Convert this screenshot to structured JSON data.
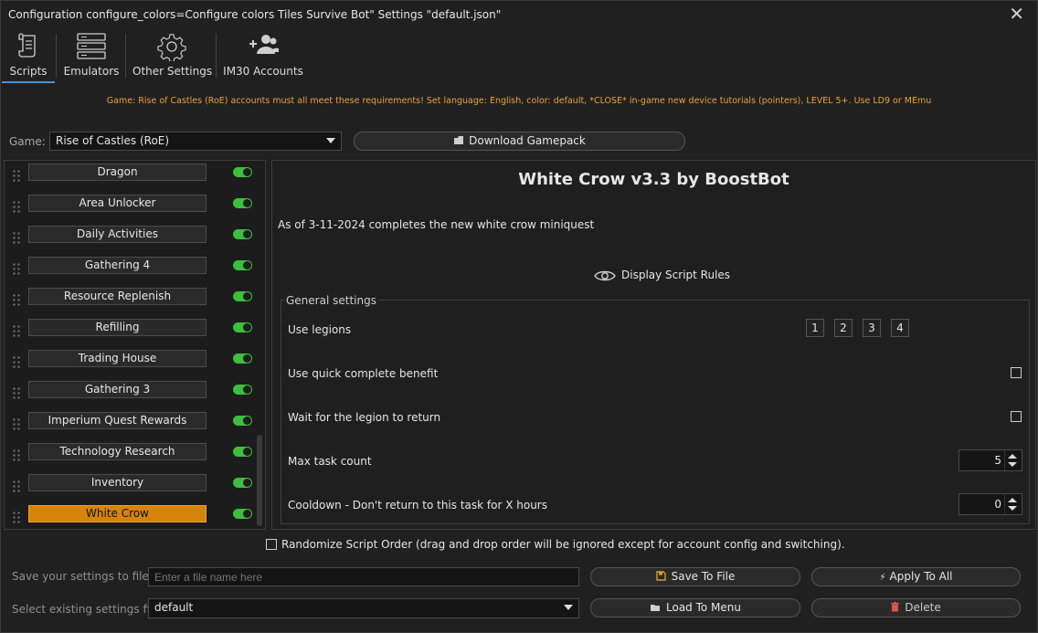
{
  "window": {
    "title": "Configuration configure_colors=Configure colors Tiles Survive Bot\" Settings \"default.json\"",
    "close_glyph": "✕"
  },
  "tabs": [
    {
      "label": "Scripts",
      "icon": "scroll-icon"
    },
    {
      "label": "Emulators",
      "icon": "server-icon"
    },
    {
      "label": "Other Settings",
      "icon": "gear-icon"
    },
    {
      "label": "IM30 Accounts",
      "icon": "users-add-icon"
    }
  ],
  "notice": "Game: Rise of Castles (RoE) accounts must all meet these requirements! Set language: English, color: default, *CLOSE* in-game new device tutorials (pointers), LEVEL 5+. Use LD9 or MEmu",
  "game": {
    "label": "Game:",
    "selected": "Rise of Castles (RoE)",
    "download_label": "Download Gamepack"
  },
  "scripts": [
    {
      "name": "Dragon",
      "enabled": true,
      "selected": false
    },
    {
      "name": "Area Unlocker",
      "enabled": true,
      "selected": false
    },
    {
      "name": "Daily Activities",
      "enabled": true,
      "selected": false
    },
    {
      "name": "Gathering 4",
      "enabled": true,
      "selected": false
    },
    {
      "name": "Resource Replenish",
      "enabled": true,
      "selected": false
    },
    {
      "name": "Refilling",
      "enabled": true,
      "selected": false
    },
    {
      "name": "Trading House",
      "enabled": true,
      "selected": false
    },
    {
      "name": "Gathering 3",
      "enabled": true,
      "selected": false
    },
    {
      "name": "Imperium Quest Rewards",
      "enabled": true,
      "selected": false
    },
    {
      "name": "Technology Research",
      "enabled": true,
      "selected": false
    },
    {
      "name": "Inventory",
      "enabled": true,
      "selected": false
    },
    {
      "name": "White Crow",
      "enabled": true,
      "selected": true
    }
  ],
  "panel": {
    "title": "White Crow v3.3 by BoostBot",
    "description": "As of 3-11-2024 completes the new white crow miniquest",
    "rules_label": "Display Script Rules",
    "group_label": "General settings",
    "settings": {
      "use_legions": {
        "label": "Use legions",
        "options": [
          "1",
          "2",
          "3",
          "4"
        ]
      },
      "quick_complete": {
        "label": "Use quick complete benefit",
        "checked": false
      },
      "wait_return": {
        "label": "Wait for the legion to return",
        "checked": false
      },
      "max_task": {
        "label": "Max task count",
        "value": "5"
      },
      "cooldown": {
        "label": "Cooldown - Don't return to this task for X hours",
        "value": "0"
      }
    }
  },
  "randomize": {
    "label": "Randomize Script Order (drag and drop order will be ignored except for account config and switching).",
    "checked": false
  },
  "footer": {
    "save_label": "Save your settings to file",
    "save_placeholder": "Enter a file name here",
    "save_button": "Save To File",
    "apply_button": "Apply To All",
    "select_label": "Select existing settings file",
    "select_value": "default",
    "load_button": "Load To Menu",
    "delete_button": "Delete"
  },
  "colors": {
    "accent": "#d4840a",
    "toggle_on": "#3cbf3c",
    "notice": "#e8a33a",
    "delete_icon": "#d9534f",
    "tab_underline": "#4a90d9"
  }
}
